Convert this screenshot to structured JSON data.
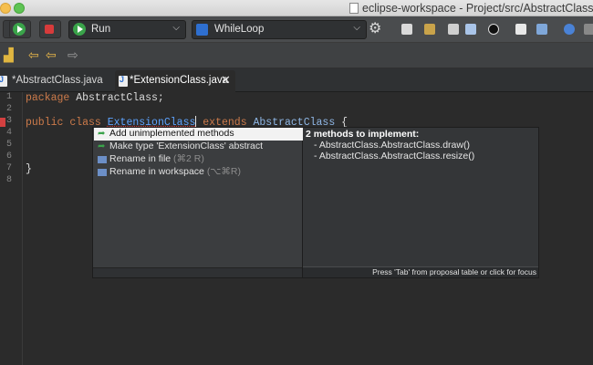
{
  "window": {
    "title": "eclipse-workspace - Project/src/AbstractClass/E"
  },
  "toolbar": {
    "run_config_label": "Run",
    "launch_target_label": "WhileLoop"
  },
  "tabs": [
    {
      "label": "*AbstractClass.java",
      "active": false
    },
    {
      "label": "*ExtensionClass.java",
      "active": true
    }
  ],
  "editor": {
    "line_numbers": [
      "1",
      "2",
      "3",
      "4",
      "5",
      "6",
      "7",
      "8"
    ],
    "lines": [
      {
        "kw1": "package",
        "rest": " AbstractClass;"
      },
      {
        "kw1": "public",
        "kw2": "class",
        "name": "ExtensionClass",
        "kw3": "extends",
        "sup": "AbstractClass",
        "tail": " {"
      },
      {
        "text": "}"
      }
    ]
  },
  "quickfix": {
    "proposals": [
      {
        "label": "Add unimplemented methods",
        "selected": true
      },
      {
        "label": "Make type 'ExtensionClass' abstract",
        "selected": false
      },
      {
        "label": "Rename in file",
        "hint": "(⌘2 R)",
        "selected": false
      },
      {
        "label": "Rename in workspace",
        "hint": "(⌥⌘R)",
        "selected": false
      }
    ],
    "detail": {
      "title": "2 methods to implement:",
      "items": [
        "- AbstractClass.AbstractClass.draw()",
        "- AbstractClass.AbstractClass.resize()"
      ]
    },
    "status": "Press 'Tab' from proposal table or click for focus"
  },
  "colors": {
    "editor_bg": "#2b2b2b",
    "keyword": "#cc7a4a",
    "type_name": "#8fb7e6",
    "selection_bg": "#f2f2f2",
    "error_marker": "#d34040"
  }
}
